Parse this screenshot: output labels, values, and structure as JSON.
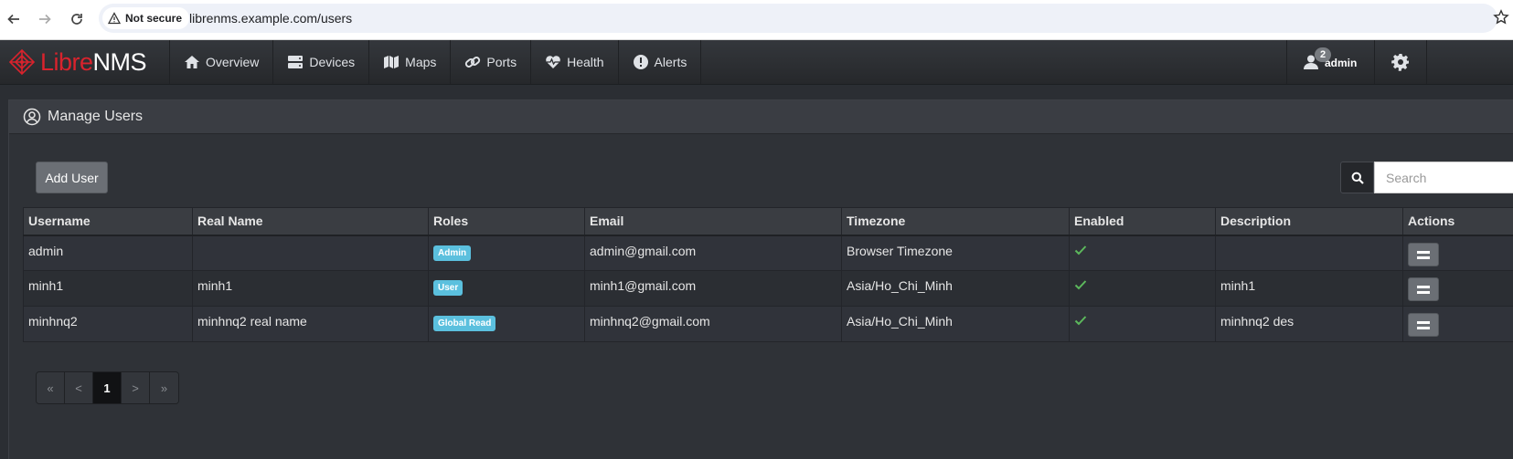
{
  "browser": {
    "security_label": "Not secure",
    "url": "librenms.example.com/users"
  },
  "brand": {
    "libre": "Libre",
    "nms": "NMS"
  },
  "nav": {
    "items": [
      {
        "label": "Overview",
        "icon": "home-icon"
      },
      {
        "label": "Devices",
        "icon": "server-icon"
      },
      {
        "label": "Maps",
        "icon": "map-icon"
      },
      {
        "label": "Ports",
        "icon": "link-icon"
      },
      {
        "label": "Health",
        "icon": "heartbeat-icon"
      },
      {
        "label": "Alerts",
        "icon": "exclamation-circle-icon"
      }
    ],
    "user": {
      "name": "admin",
      "badge": "2"
    }
  },
  "panel": {
    "title": "Manage Users",
    "add_button": "Add User",
    "search_placeholder": "Search"
  },
  "table": {
    "columns": [
      "Username",
      "Real Name",
      "Roles",
      "Email",
      "Timezone",
      "Enabled",
      "Description",
      "Actions"
    ],
    "rows": [
      {
        "username": "admin",
        "real_name": "",
        "role": "Admin",
        "email": "admin@gmail.com",
        "timezone": "Browser Timezone",
        "enabled": true,
        "description": ""
      },
      {
        "username": "minh1",
        "real_name": "minh1",
        "role": "User",
        "email": "minh1@gmail.com",
        "timezone": "Asia/Ho_Chi_Minh",
        "enabled": true,
        "description": "minh1"
      },
      {
        "username": "minhnq2",
        "real_name": "minhnq2 real name",
        "role": "Global Read",
        "email": "minhnq2@gmail.com",
        "timezone": "Asia/Ho_Chi_Minh",
        "enabled": true,
        "description": "minhnq2 des"
      }
    ]
  },
  "pagination": {
    "first": "«",
    "prev": "<",
    "current": "1",
    "next": ">",
    "last": "»"
  },
  "colors": {
    "brand_red": "#d9232d",
    "role_label": "#5bc0de",
    "enabled_check": "#5cb85c"
  }
}
